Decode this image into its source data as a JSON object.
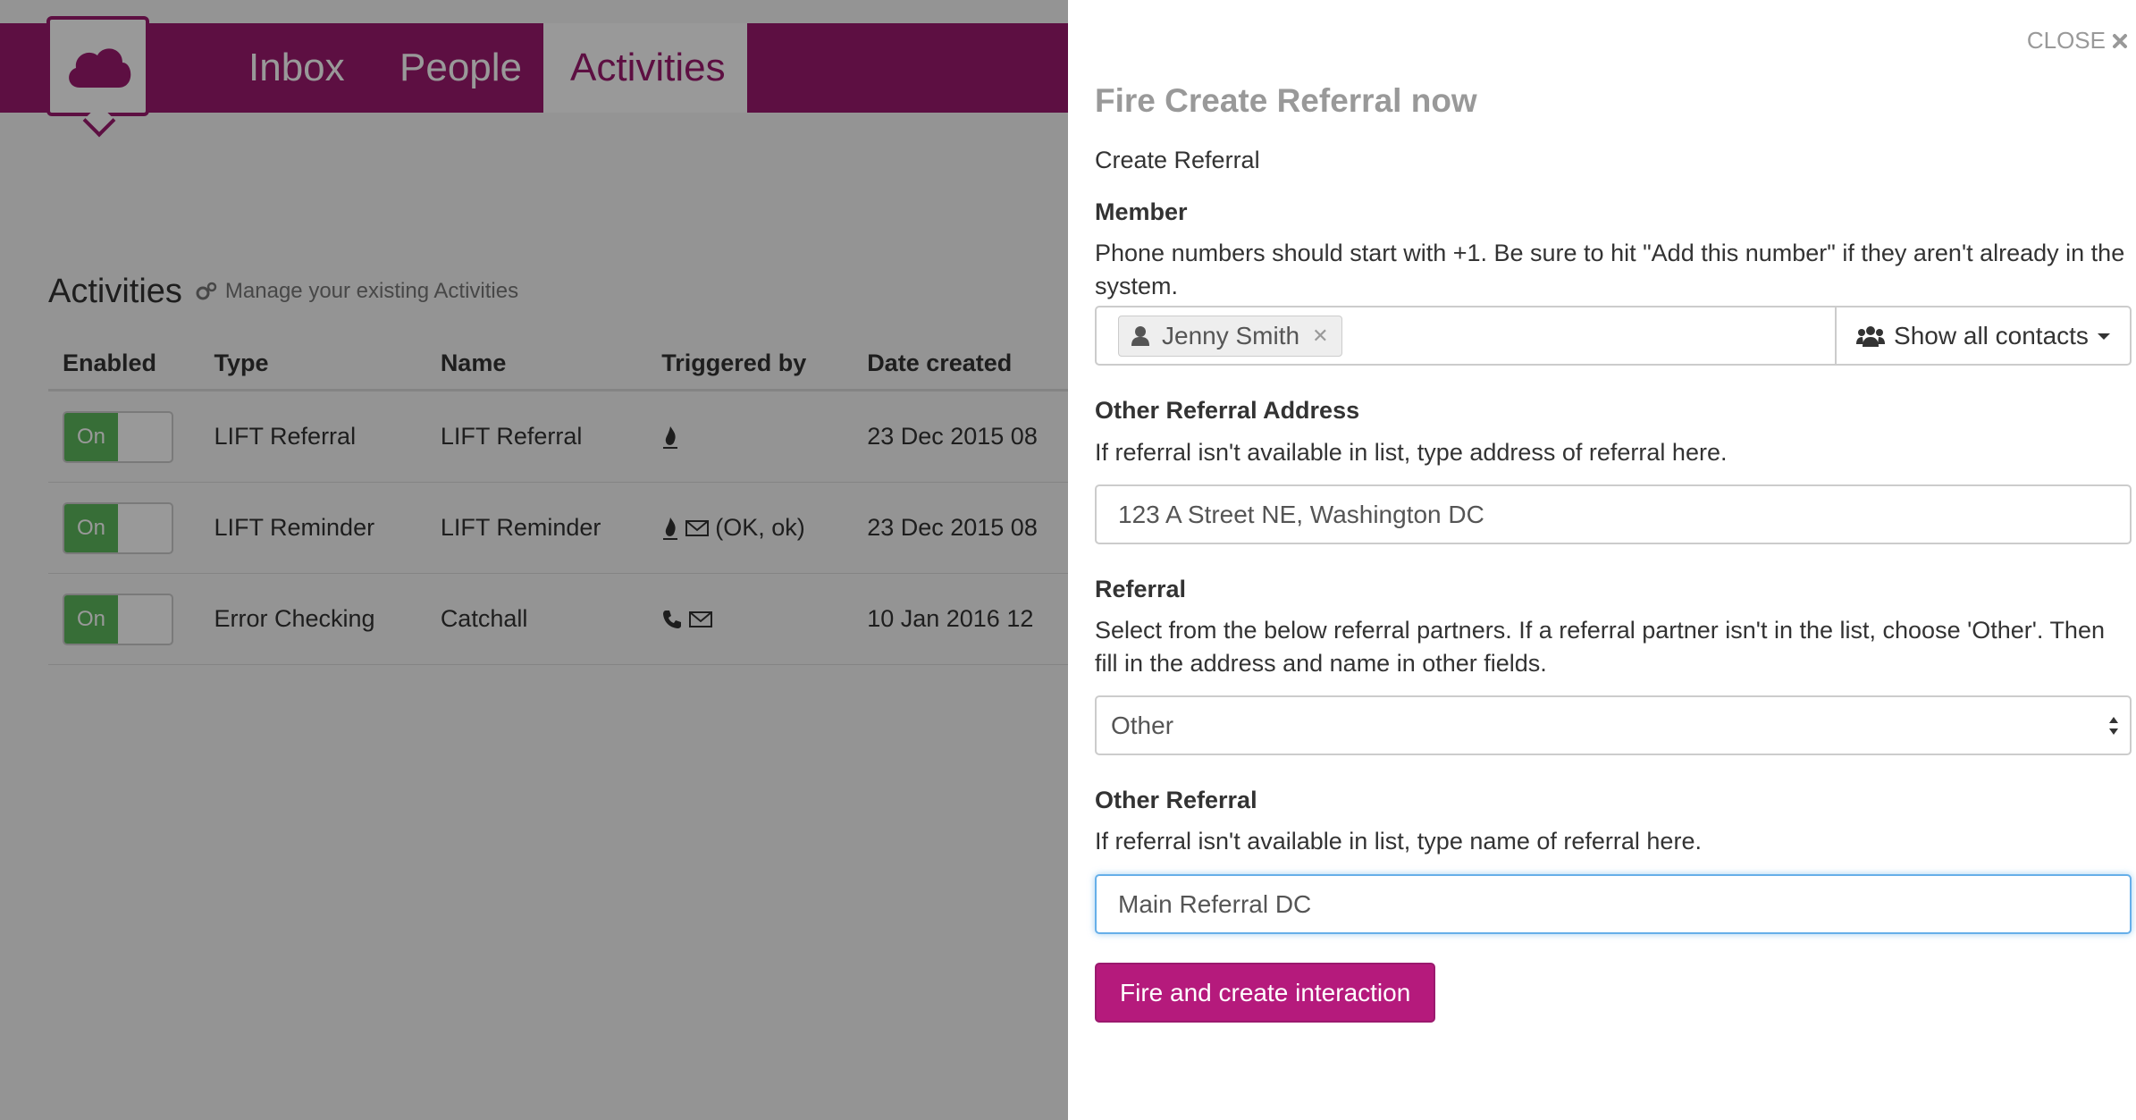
{
  "nav": {
    "items": [
      {
        "label": "Inbox"
      },
      {
        "label": "People"
      },
      {
        "label": "Activities"
      }
    ]
  },
  "activities": {
    "title": "Activities",
    "subtitle": "Manage your existing Activities",
    "columns": [
      "Enabled",
      "Type",
      "Name",
      "Triggered by",
      "Date created"
    ],
    "rows": [
      {
        "enabled": "On",
        "type": "LIFT Referral",
        "name": "LIFT Referral",
        "trigger_text": "",
        "date": "23 Dec 2015 08"
      },
      {
        "enabled": "On",
        "type": "LIFT Reminder",
        "name": "LIFT Reminder",
        "trigger_text": "(OK, ok)",
        "date": "23 Dec 2015 08"
      },
      {
        "enabled": "On",
        "type": "Error Checking",
        "name": "Catchall",
        "trigger_text": "",
        "date": "10 Jan 2016 12"
      }
    ]
  },
  "panel": {
    "close_label": "CLOSE",
    "title": "Fire Create Referral now",
    "subtitle": "Create Referral",
    "member": {
      "label": "Member",
      "help": "Phone numbers should start with +1. Be sure to hit \"Add this number\" if they aren't already in the system.",
      "tag": "Jenny Smith",
      "show_contacts": "Show all contacts"
    },
    "other_address": {
      "label": "Other Referral Address",
      "help": "If referral isn't available in list, type address of referral here.",
      "value": "123 A Street NE, Washington DC"
    },
    "referral": {
      "label": "Referral",
      "help": "Select from the below referral partners. If a referral partner isn't in the list, choose 'Other'. Then fill in the address and name in other fields.",
      "selected": "Other"
    },
    "other_referral": {
      "label": "Other Referral",
      "help": "If referral isn't available in list, type name of referral here.",
      "value": "Main Referral DC"
    },
    "submit_label": "Fire and create interaction"
  },
  "colors": {
    "brand": "#9b1a6e",
    "button": "#b51a7c",
    "toggle_on": "#5cb85c",
    "focus": "#66afe9"
  }
}
